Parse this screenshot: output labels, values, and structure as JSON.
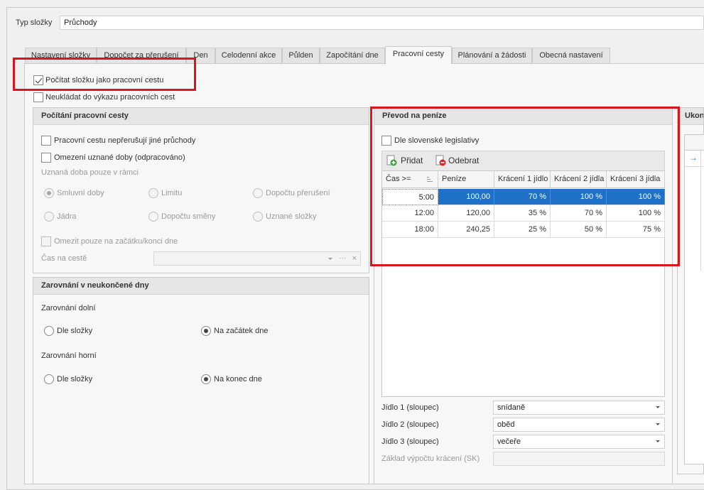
{
  "header": {
    "type_label": "Typ složky",
    "type_value": "Průchody"
  },
  "tabs": [
    {
      "label": "Nastavení složky"
    },
    {
      "label": "Dopočet za přerušení"
    },
    {
      "label": "Den"
    },
    {
      "label": "Celodenní akce"
    },
    {
      "label": "Půlden"
    },
    {
      "label": "Započítání dne"
    },
    {
      "label": "Pracovní cesty"
    },
    {
      "label": "Plánování a žádosti"
    },
    {
      "label": "Obecná nastavení"
    }
  ],
  "top_options": {
    "count_as_trip": "Počítat složku jako pracovní cestu",
    "dont_save": "Neukládat do výkazu pracovních cest"
  },
  "trip_calc": {
    "title": "Počítání pracovní cesty",
    "not_interrupted": "Pracovní cestu nepřerušují jiné průchody",
    "limit_time": "Omezení uznané doby (odpracováno)",
    "recognized_within": "Uznaná doba pouze v rámci",
    "radios": [
      "Smluvní doby",
      "Limitu",
      "Dopočtu přerušení",
      "Jádra",
      "Dopočtu směny",
      "Uznané složky"
    ],
    "limit_start_end": "Omezit pouze na začátku/konci dne",
    "travel_time": "Čas na cestě",
    "combo_ellipsis": "···",
    "combo_clear": "×"
  },
  "rounding": {
    "title": "Zarovnání v neukončené dny",
    "lower_label": "Zarovnání dolní",
    "lower_opt1": "Dle složky",
    "lower_opt2": "Na začátek dne",
    "upper_label": "Zarovnání horní",
    "upper_opt1": "Dle složky",
    "upper_opt2": "Na konec dne"
  },
  "money": {
    "title": "Převod na peníze",
    "slovak": "Dle slovenské legislativy",
    "add": "Přidat",
    "remove": "Odebrat",
    "columns": [
      "Čas >=",
      "Peníze",
      "Krácení 1 jídlo",
      "Krácení 2 jídla",
      "Krácení 3 jídla"
    ],
    "rows": [
      [
        "5:00",
        "100,00",
        "70 %",
        "100 %",
        "100 %"
      ],
      [
        "12:00",
        "120,00",
        "35 %",
        "70 %",
        "100 %"
      ],
      [
        "18:00",
        "240,25",
        "25 %",
        "50 %",
        "75 %"
      ]
    ],
    "meal1_label": "Jídlo 1 (sloupec)",
    "meal1_value": "snídaně",
    "meal2_label": "Jídlo 2 (sloupec)",
    "meal2_value": "oběd",
    "meal3_label": "Jídlo 3 (sloupec)",
    "meal3_value": "večeře",
    "basis_label": "Základ výpočtu krácení (SK)"
  },
  "right_panel": {
    "title": "Ukon",
    "arrow": "→"
  },
  "colors": {
    "highlight": "#d9161d",
    "selection": "#1f70c9"
  }
}
